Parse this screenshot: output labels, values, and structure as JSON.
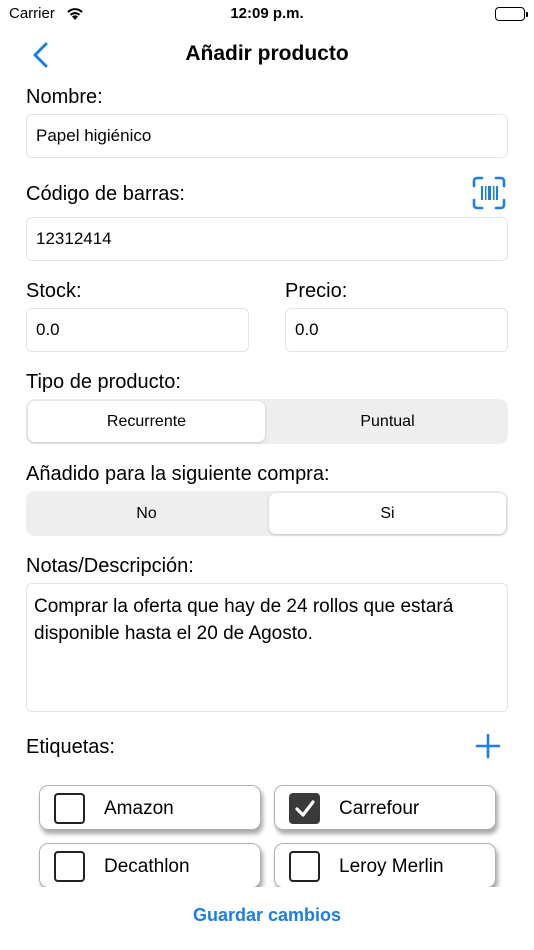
{
  "status_bar": {
    "carrier": "Carrier",
    "time": "12:09 p.m."
  },
  "nav": {
    "title": "Añadir producto",
    "back_icon": "chevron-left-icon"
  },
  "form": {
    "nombre": {
      "label": "Nombre:",
      "value": "Papel higiénico"
    },
    "codigo": {
      "label": "Código de barras:",
      "value": "12312414",
      "scan_icon": "barcode-scan-icon"
    },
    "stock": {
      "label": "Stock:",
      "value": "0.0"
    },
    "precio": {
      "label": "Precio:",
      "value": "0.0"
    },
    "tipo": {
      "label": "Tipo de producto:",
      "options": [
        "Recurrente",
        "Puntual"
      ],
      "selected": "Recurrente"
    },
    "siguiente_compra": {
      "label": "Añadido para la siguiente compra:",
      "options": [
        "No",
        "Si"
      ],
      "selected": "Si"
    },
    "notas": {
      "label": "Notas/Descripción:",
      "value": "Comprar la oferta que hay de 24 rollos que estará disponible hasta el 20 de Agosto."
    },
    "etiquetas": {
      "label": "Etiquetas:",
      "add_icon": "plus-icon",
      "items": [
        {
          "label": "Amazon",
          "checked": false
        },
        {
          "label": "Carrefour",
          "checked": true
        },
        {
          "label": "Decathlon",
          "checked": false
        },
        {
          "label": "Leroy Merlin",
          "checked": false
        }
      ]
    }
  },
  "save_label": "Guardar cambios",
  "colors": {
    "accent": "#1a7ee6",
    "field_border": "#e3e3e6",
    "segment_bg": "#eeeeef",
    "checkbox_checked": "#3a3a3a"
  }
}
